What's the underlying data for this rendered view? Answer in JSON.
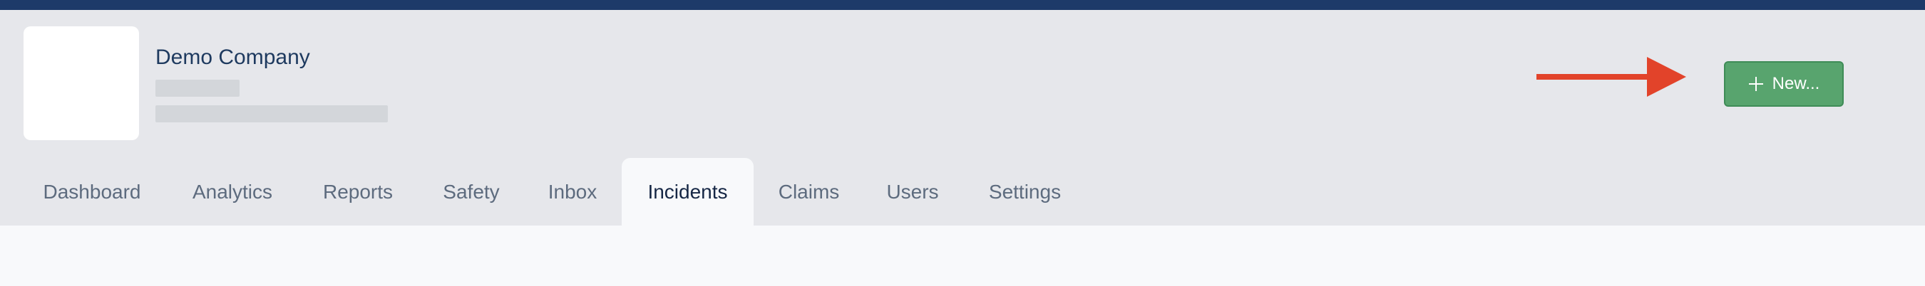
{
  "header": {
    "company_name": "Demo Company",
    "new_button_label": "New...",
    "accent_color": "#58a46e",
    "top_bar_color": "#1d3a69",
    "arrow_color": "#e2432a"
  },
  "tabs": [
    {
      "label": "Dashboard",
      "active": false
    },
    {
      "label": "Analytics",
      "active": false
    },
    {
      "label": "Reports",
      "active": false
    },
    {
      "label": "Safety",
      "active": false
    },
    {
      "label": "Inbox",
      "active": false
    },
    {
      "label": "Incidents",
      "active": true
    },
    {
      "label": "Claims",
      "active": false
    },
    {
      "label": "Users",
      "active": false
    },
    {
      "label": "Settings",
      "active": false
    }
  ]
}
